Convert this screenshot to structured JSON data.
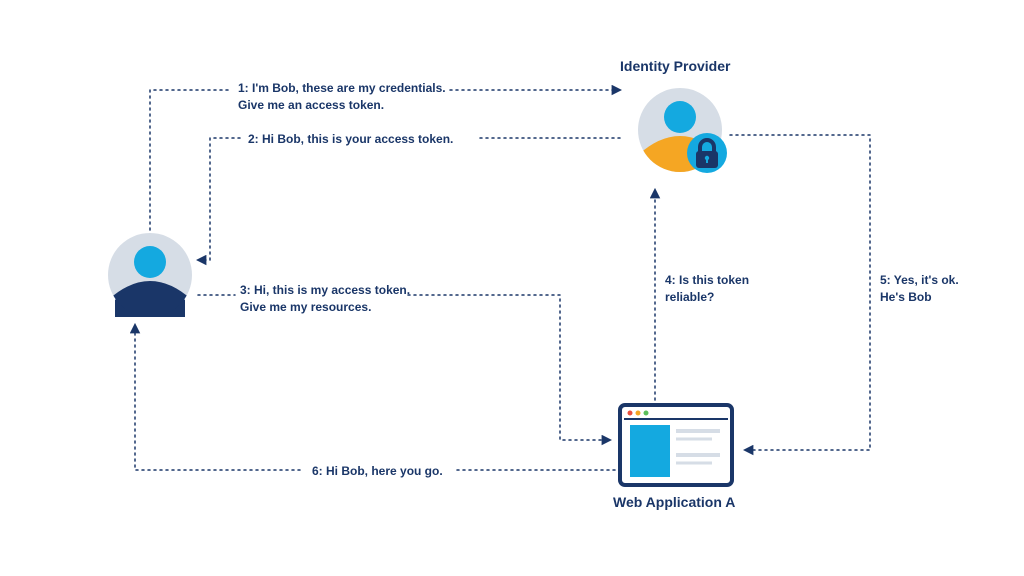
{
  "identityProvider": {
    "title": "Identity Provider"
  },
  "webApp": {
    "title": "Web Application A"
  },
  "steps": {
    "s1": {
      "line1": "1: I'm Bob, these are my credentials.",
      "line2": "Give me an access token."
    },
    "s2": {
      "text": "2: Hi Bob, this is your access token."
    },
    "s3": {
      "line1": "3: Hi, this is my access token.",
      "line2": "Give me my resources."
    },
    "s4": {
      "line1": "4: Is this token",
      "line2": "reliable?"
    },
    "s5": {
      "line1": "5: Yes, it's ok.",
      "line2": "He's Bob"
    },
    "s6": {
      "text": "6: Hi Bob, here you go."
    }
  }
}
